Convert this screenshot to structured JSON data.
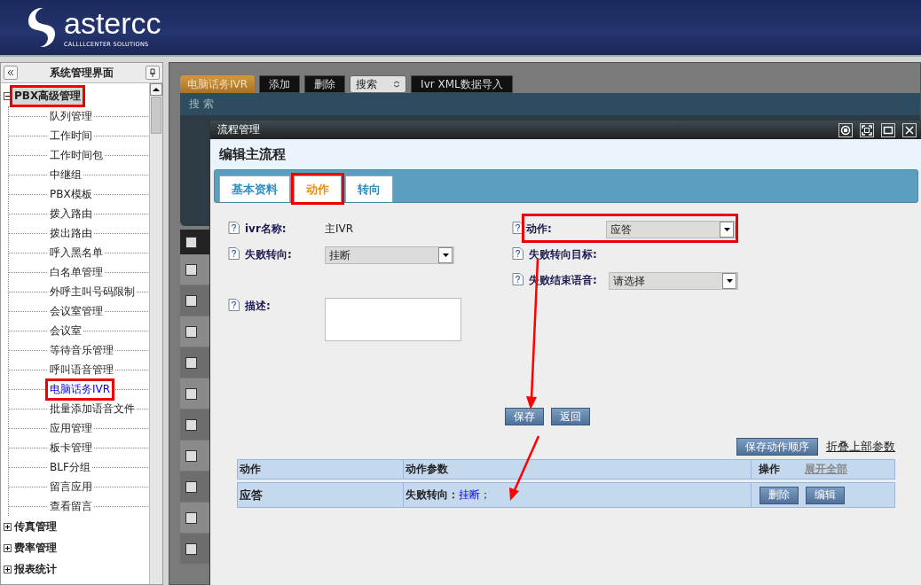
{
  "header": {
    "logo_text": "astercc",
    "tagline": "CALLLLCENTER SOLUTIONS"
  },
  "sidebar": {
    "title": "系统管理界面",
    "tree": [
      {
        "label": "PBX高级管理",
        "expanded": true,
        "highlighted": true,
        "children": [
          {
            "label": "队列管理",
            "selected": false,
            "highlighted": false
          },
          {
            "label": "工作时间",
            "selected": false,
            "highlighted": false
          },
          {
            "label": "工作时间包",
            "selected": false,
            "highlighted": false
          },
          {
            "label": "中继组",
            "selected": false,
            "highlighted": false
          },
          {
            "label": "PBX模板",
            "selected": false,
            "highlighted": false
          },
          {
            "label": "拨入路由",
            "selected": false,
            "highlighted": false
          },
          {
            "label": "拨出路由",
            "selected": false,
            "highlighted": false
          },
          {
            "label": "呼入黑名单",
            "selected": false,
            "highlighted": false
          },
          {
            "label": "白名单管理",
            "selected": false,
            "highlighted": false
          },
          {
            "label": "外呼主叫号码限制",
            "selected": false,
            "highlighted": false
          },
          {
            "label": "会议室管理",
            "selected": false,
            "highlighted": false
          },
          {
            "label": "会议室",
            "selected": false,
            "highlighted": false
          },
          {
            "label": "等待音乐管理",
            "selected": false,
            "highlighted": false
          },
          {
            "label": "呼叫语音管理",
            "selected": false,
            "highlighted": false
          },
          {
            "label": "电脑话务IVR",
            "selected": true,
            "highlighted": true
          },
          {
            "label": "批量添加语音文件",
            "selected": false,
            "highlighted": false
          },
          {
            "label": "应用管理",
            "selected": false,
            "highlighted": false
          },
          {
            "label": "板卡管理",
            "selected": false,
            "highlighted": false
          },
          {
            "label": "BLF分组",
            "selected": false,
            "highlighted": false
          },
          {
            "label": "留言应用",
            "selected": false,
            "highlighted": false
          },
          {
            "label": "查看留言",
            "selected": false,
            "highlighted": false
          }
        ]
      },
      {
        "label": "传真管理",
        "expanded": false,
        "highlighted": false
      },
      {
        "label": "费率管理",
        "expanded": false,
        "highlighted": false
      },
      {
        "label": "报表统计",
        "expanded": false,
        "highlighted": false
      }
    ]
  },
  "toolbar": {
    "tab": "电脑话务IVR",
    "buttons": [
      "添加",
      "删除"
    ],
    "search_select": "搜索",
    "import_button": "Ivr XML数据导入"
  },
  "search_bar": {
    "label": "搜 索"
  },
  "background_table": {
    "header_checked": false,
    "rows": [
      {
        "checked": false
      },
      {
        "checked": false
      },
      {
        "checked": false
      },
      {
        "checked": false
      },
      {
        "checked": false
      },
      {
        "checked": false
      },
      {
        "checked": false
      },
      {
        "checked": false
      },
      {
        "checked": false
      },
      {
        "checked": false
      }
    ]
  },
  "dialog": {
    "title": "流程管理",
    "heading": "编辑主流程",
    "tabs": [
      {
        "label": "基本资料",
        "selected": false,
        "highlighted": false
      },
      {
        "label": "动作",
        "selected": true,
        "highlighted": true
      },
      {
        "label": "转向",
        "selected": false,
        "highlighted": false
      }
    ],
    "left_fields": [
      {
        "kind": "text",
        "label": "ivr名称:",
        "value": "主IVR",
        "highlighted": false
      },
      {
        "kind": "select",
        "label": "失败转向:",
        "value": "挂断",
        "highlighted": false
      },
      {
        "kind": "textarea",
        "label": "描述:",
        "highlighted": false
      }
    ],
    "right_fields": [
      {
        "kind": "select",
        "label": "动作:",
        "value": "应答",
        "highlighted": true
      },
      {
        "kind": "empty",
        "label": "失败转向目标:",
        "highlighted": false
      },
      {
        "kind": "select",
        "label": "失败结束语音:",
        "value": "请选择",
        "highlighted": false
      }
    ],
    "buttons": [
      "保存",
      "返回"
    ],
    "save_order_button": "保存动作顺序",
    "collapse_link": "折叠上部参数",
    "action_table": {
      "columns": [
        "动作",
        "动作参数",
        "操作"
      ],
      "expand_all": "展开全部",
      "rows": [
        {
          "action": "应答",
          "param_label": "失败转向：",
          "param_value": "挂断",
          "param_suffix": "；",
          "buttons": [
            "删除",
            "编辑"
          ]
        }
      ]
    }
  }
}
